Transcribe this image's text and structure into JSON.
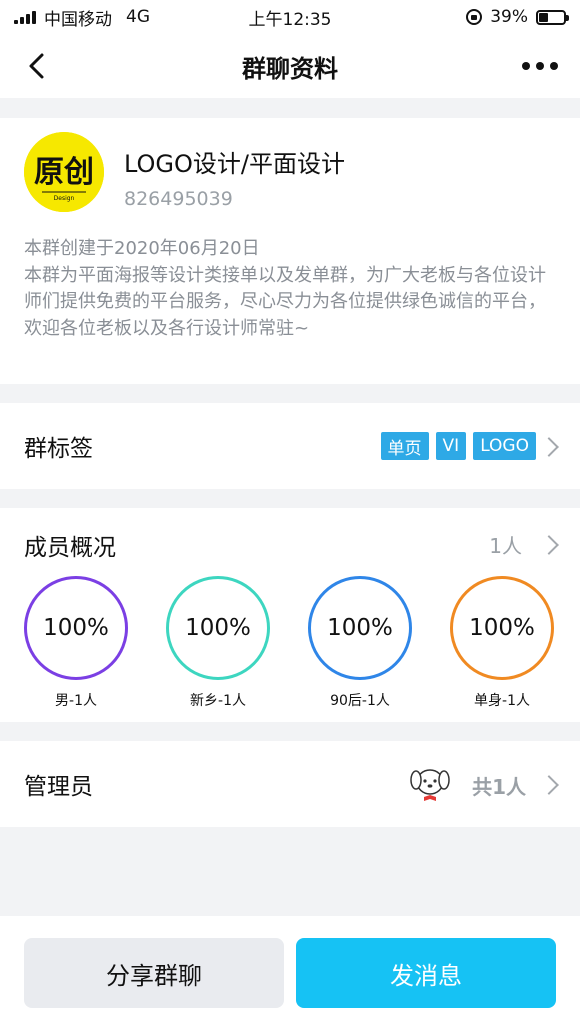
{
  "statusbar": {
    "carrier": "中国移动",
    "network": "4G",
    "time": "上午12:35",
    "battery": "39%",
    "battery_level": 0.39
  },
  "nav": {
    "title": "群聊资料",
    "back_icon": "chevron-left-icon",
    "more_icon": "more-icon"
  },
  "group": {
    "name": "LOGO设计/平面设计",
    "id": "826495039",
    "description": "本群创建于2020年06月20日\n本群为平面海报等设计类接单以及发单群，为广大老板与各位设计师们提供免费的平台服务，尽心尽力为各位提供绿色诚信的平台，欢迎各位老板以及各行设计师常驻~",
    "avatar_text": "原创",
    "avatar_subtext": "Design"
  },
  "tags": {
    "title": "群标签",
    "items": [
      "单页",
      "VI",
      "LOGO"
    ],
    "tag_color": "#2ea9e6"
  },
  "members": {
    "title": "成员概况",
    "count": "1人",
    "stats": [
      {
        "value": "100%",
        "label": "男-1人",
        "color": "#7b3fe4"
      },
      {
        "value": "100%",
        "label": "新乡-1人",
        "color": "#3dd6c0"
      },
      {
        "value": "100%",
        "label": "90后-1人",
        "color": "#2f86e8"
      },
      {
        "value": "100%",
        "label": "单身-1人",
        "color": "#f08a22"
      }
    ]
  },
  "admin": {
    "title": "管理员",
    "total": "共1人"
  },
  "actions": {
    "share_label": "分享群聊",
    "send_label": "发消息",
    "send_color": "#16c2f4"
  }
}
